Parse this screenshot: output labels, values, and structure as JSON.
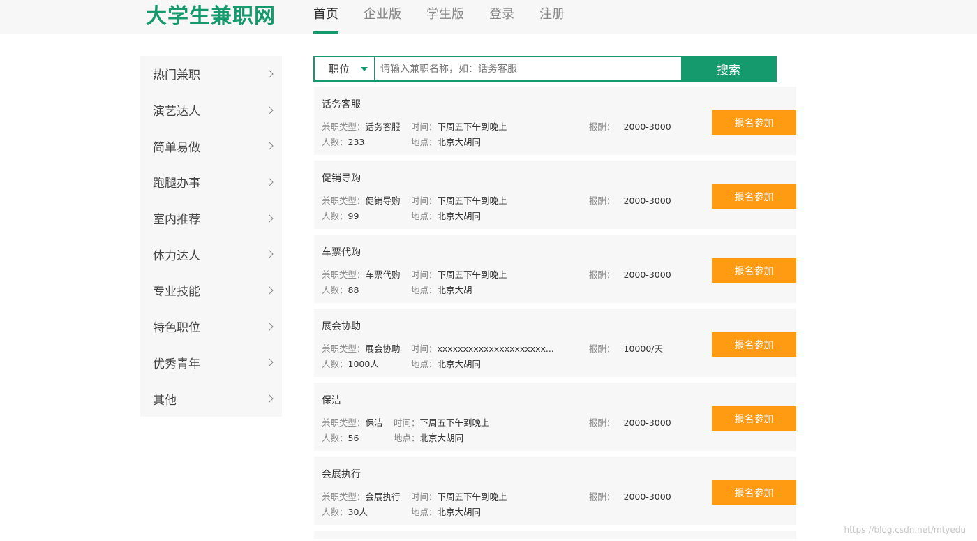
{
  "header": {
    "logo": "大学生兼职网",
    "nav": [
      {
        "label": "首页",
        "active": true
      },
      {
        "label": "企业版",
        "active": false
      },
      {
        "label": "学生版",
        "active": false
      },
      {
        "label": "登录",
        "active": false
      },
      {
        "label": "注册",
        "active": false
      }
    ]
  },
  "sidebar": {
    "items": [
      {
        "label": "热门兼职"
      },
      {
        "label": "演艺达人"
      },
      {
        "label": "简单易做"
      },
      {
        "label": "跑腿办事"
      },
      {
        "label": "室内推荐"
      },
      {
        "label": "体力达人"
      },
      {
        "label": "专业技能"
      },
      {
        "label": "特色职位"
      },
      {
        "label": "优秀青年"
      },
      {
        "label": "其他"
      }
    ]
  },
  "search": {
    "select_value": "职位",
    "placeholder": "请输入兼职名称，如：话务客服",
    "button_label": "搜索"
  },
  "labels": {
    "type": "兼职类型：",
    "time": "时间：",
    "count": "人数：",
    "place": "地点：",
    "pay": "报酬：",
    "apply": "报名参加"
  },
  "jobs": [
    {
      "title": "话务客服",
      "type": "话务客服",
      "time": "下周五下午到晚上",
      "count": "233",
      "place": "北京大胡同",
      "pay": "2000-3000"
    },
    {
      "title": "促销导购",
      "type": "促销导购",
      "time": "下周五下午到晚上",
      "count": "99",
      "place": "北京大胡同",
      "pay": "2000-3000"
    },
    {
      "title": "车票代购",
      "type": "车票代购",
      "time": "下周五下午到晚上",
      "count": "88",
      "place": "北京大胡",
      "pay": "2000-3000"
    },
    {
      "title": "展会协助",
      "type": "展会协助",
      "time": "xxxxxxxxxxxxxxxxxxxxx...",
      "count": "1000人",
      "place": "北京大胡同",
      "pay": "10000/天"
    },
    {
      "title": "保洁",
      "type": "保洁",
      "time": "下周五下午到晚上",
      "count": "56",
      "place": "北京大胡同",
      "pay": "2000-3000"
    },
    {
      "title": "会展执行",
      "type": "会展执行",
      "time": "下周五下午到晚上",
      "count": "30人",
      "place": "北京大胡同",
      "pay": "2000-3000"
    }
  ],
  "watermark": "https://blog.csdn.net/mtyedu",
  "colors": {
    "brand": "#159a6e",
    "apply": "#ff9a13",
    "panel": "#f7f7f7"
  }
}
